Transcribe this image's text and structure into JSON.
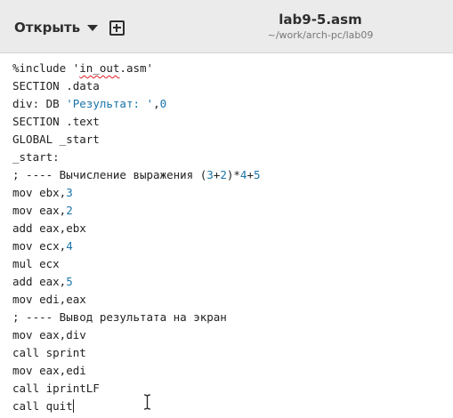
{
  "header": {
    "open_label": "Открыть",
    "title": "lab9-5.asm",
    "path": "~/work/arch-pc/lab09"
  },
  "editor": {
    "lines": [
      [
        {
          "t": "%include '",
          "k": "txt"
        },
        {
          "t": "in_out",
          "k": "sq"
        },
        {
          "t": ".asm'",
          "k": "txt"
        }
      ],
      [
        {
          "t": "SECTION .data",
          "k": "txt"
        }
      ],
      [
        {
          "t": "div: DB ",
          "k": "txt"
        },
        {
          "t": "'Результат: '",
          "k": "str"
        },
        {
          "t": ",",
          "k": "txt"
        },
        {
          "t": "0",
          "k": "num"
        }
      ],
      [
        {
          "t": "SECTION .text",
          "k": "txt"
        }
      ],
      [
        {
          "t": "GLOBAL _start",
          "k": "txt"
        }
      ],
      [
        {
          "t": "_start:",
          "k": "txt"
        }
      ],
      [
        {
          "t": "; ---- Вычисление выражения (",
          "k": "txt"
        },
        {
          "t": "3",
          "k": "num"
        },
        {
          "t": "+",
          "k": "txt"
        },
        {
          "t": "2",
          "k": "num"
        },
        {
          "t": ")*",
          "k": "txt"
        },
        {
          "t": "4",
          "k": "num"
        },
        {
          "t": "+",
          "k": "txt"
        },
        {
          "t": "5",
          "k": "num"
        }
      ],
      [
        {
          "t": "mov ebx,",
          "k": "txt"
        },
        {
          "t": "3",
          "k": "num"
        }
      ],
      [
        {
          "t": "mov eax,",
          "k": "txt"
        },
        {
          "t": "2",
          "k": "num"
        }
      ],
      [
        {
          "t": "add eax,ebx",
          "k": "txt"
        }
      ],
      [
        {
          "t": "mov ecx,",
          "k": "txt"
        },
        {
          "t": "4",
          "k": "num"
        }
      ],
      [
        {
          "t": "mul ecx",
          "k": "txt"
        }
      ],
      [
        {
          "t": "add eax,",
          "k": "txt"
        },
        {
          "t": "5",
          "k": "num"
        }
      ],
      [
        {
          "t": "mov edi,eax",
          "k": "txt"
        }
      ],
      [
        {
          "t": "; ---- Вывод результата на экран",
          "k": "txt"
        }
      ],
      [
        {
          "t": "mov eax,div",
          "k": "txt"
        }
      ],
      [
        {
          "t": "call sprint",
          "k": "txt"
        }
      ],
      [
        {
          "t": "mov eax,edi",
          "k": "txt"
        }
      ],
      [
        {
          "t": "call iprintLF",
          "k": "txt"
        }
      ],
      [
        {
          "t": "call quit",
          "k": "txt"
        }
      ]
    ]
  },
  "colors": {
    "header_bg": "#ebebeb",
    "number": "#1a73a8",
    "spell_error": "#e01b24"
  },
  "icons": [
    "dropdown-icon",
    "new-tab-icon",
    "text-cursor-icon"
  ]
}
